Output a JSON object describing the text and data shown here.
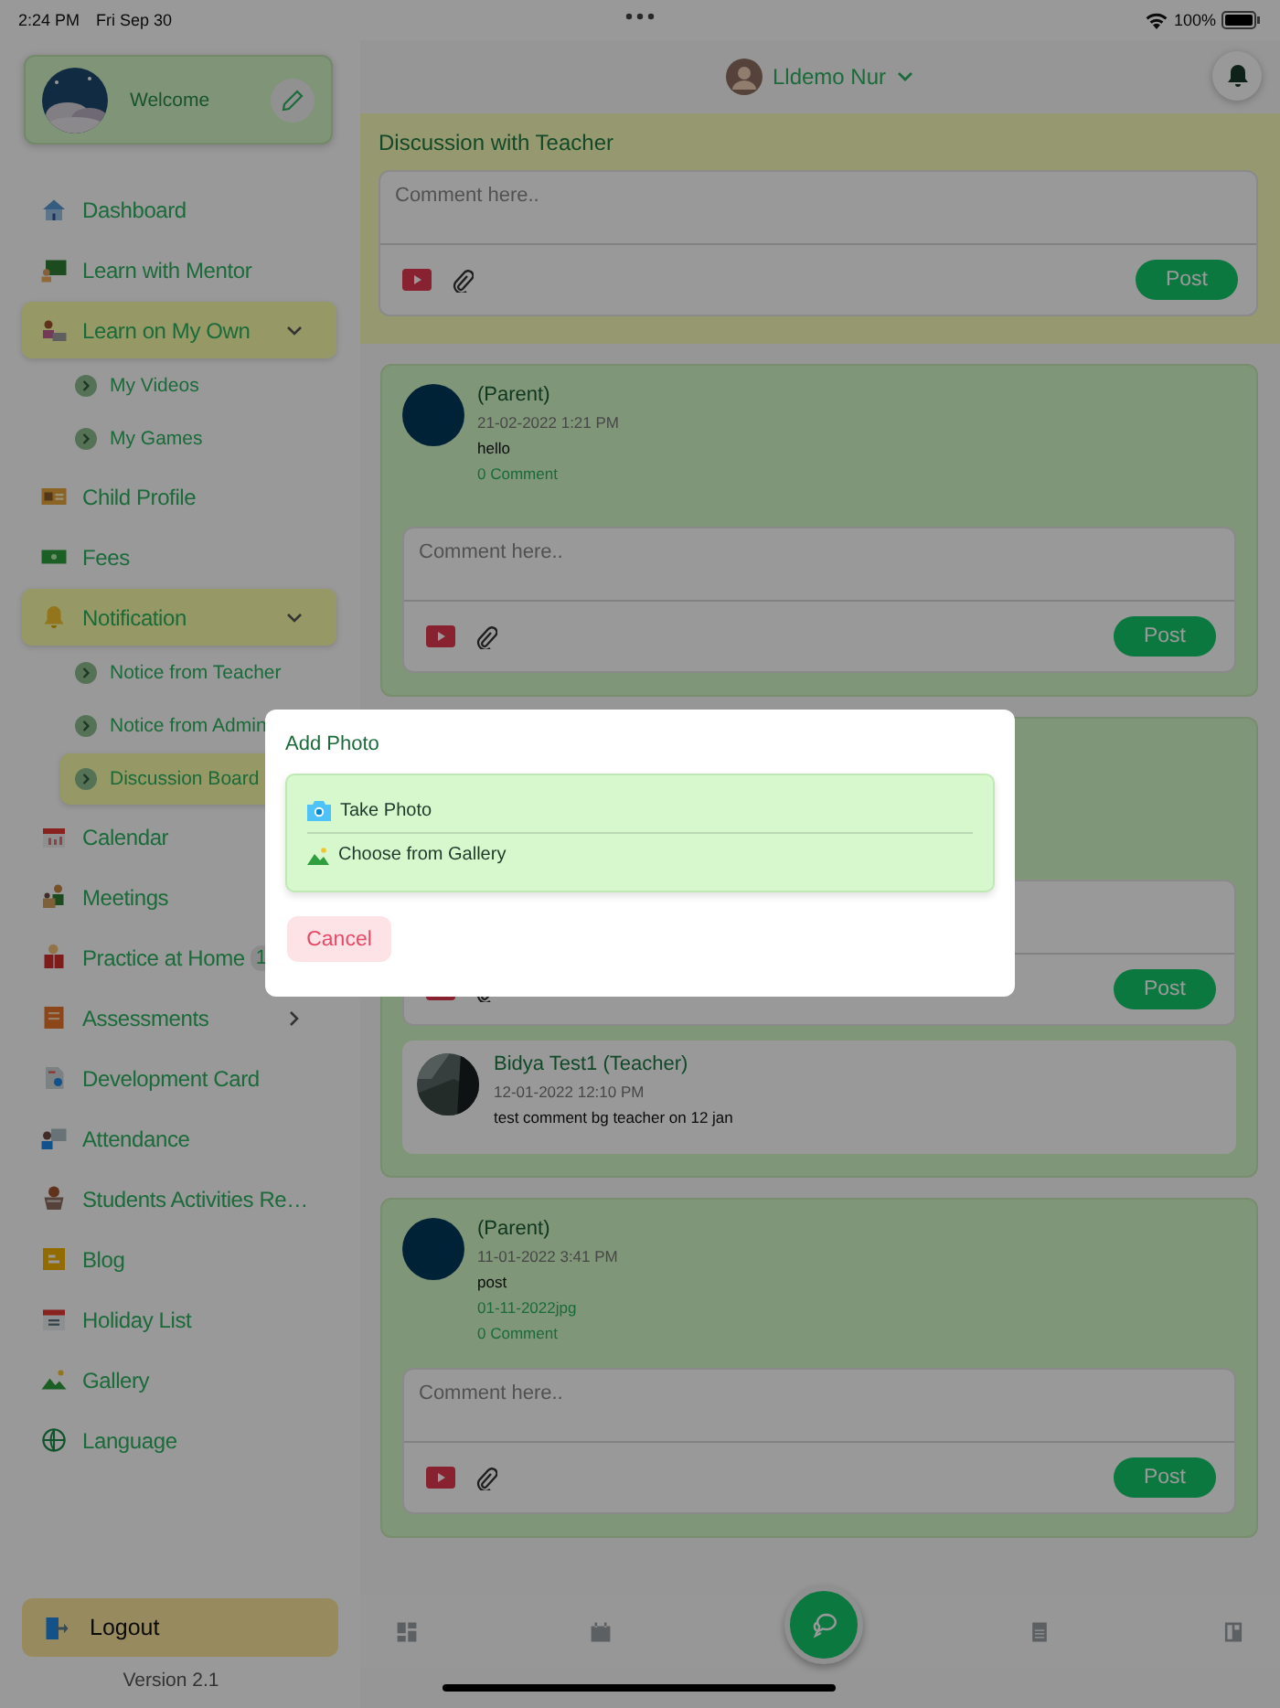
{
  "status_bar": {
    "time": "2:24 PM",
    "date": "Fri Sep 30",
    "battery": "100%"
  },
  "sidebar": {
    "profile": {
      "greeting": "Welcome"
    },
    "items": [
      {
        "label": "Dashboard",
        "selected": false
      },
      {
        "label": "Learn with Mentor",
        "selected": false
      },
      {
        "label": "Learn on My Own",
        "selected": false,
        "expanded": true,
        "children": [
          {
            "label": "My Videos",
            "selected": false
          },
          {
            "label": "My Games",
            "selected": false
          }
        ]
      },
      {
        "label": "Child Profile",
        "selected": false
      },
      {
        "label": "Fees",
        "selected": false
      },
      {
        "label": "Notification",
        "selected": false,
        "expanded": true,
        "children": [
          {
            "label": "Notice from Teacher",
            "selected": false
          },
          {
            "label": "Notice from Admin",
            "selected": false
          },
          {
            "label": "Discussion Board",
            "selected": true
          }
        ]
      },
      {
        "label": "Calendar",
        "selected": false
      },
      {
        "label": "Meetings",
        "selected": false
      },
      {
        "label": "Practice at Home",
        "selected": false,
        "badge": "1"
      },
      {
        "label": "Assessments",
        "selected": false,
        "expanded": false
      },
      {
        "label": "Development Card",
        "selected": false
      },
      {
        "label": "Attendance",
        "selected": false
      },
      {
        "label": "Students Activities Re…",
        "selected": false
      },
      {
        "label": "Blog",
        "selected": false
      },
      {
        "label": "Holiday List",
        "selected": false
      },
      {
        "label": "Gallery",
        "selected": false
      },
      {
        "label": "Language",
        "selected": false
      }
    ],
    "logout": "Logout",
    "version": "Version 2.1"
  },
  "header": {
    "user_name": "Lldemo Nur"
  },
  "composer": {
    "title": "Discussion with Teacher",
    "placeholder": "Comment here..",
    "post_button": "Post"
  },
  "posts": [
    {
      "author": "(Parent)",
      "date": "21-02-2022 1:21 PM",
      "text": "hello",
      "comment_count": "0 Comment",
      "comment_field": {
        "placeholder": "Comment here..",
        "post_button": "Post"
      }
    },
    {
      "comment_field": {
        "post_button": "Post"
      },
      "replies": [
        {
          "author": "Bidya Test1 (Teacher)",
          "date": "12-01-2022 12:10 PM",
          "text": "test comment bg teacher on 12 jan"
        }
      ]
    },
    {
      "author": "(Parent)",
      "date": "11-01-2022 3:41 PM",
      "text": "post",
      "attachment": "01-11-2022jpg",
      "comment_count": "0 Comment",
      "comment_field": {
        "placeholder": "Comment here..",
        "post_button": "Post"
      }
    }
  ],
  "dialog": {
    "title": "Add Photo",
    "options": [
      {
        "label": "Take Photo"
      },
      {
        "label": "Choose from Gallery"
      }
    ],
    "cancel": "Cancel"
  }
}
